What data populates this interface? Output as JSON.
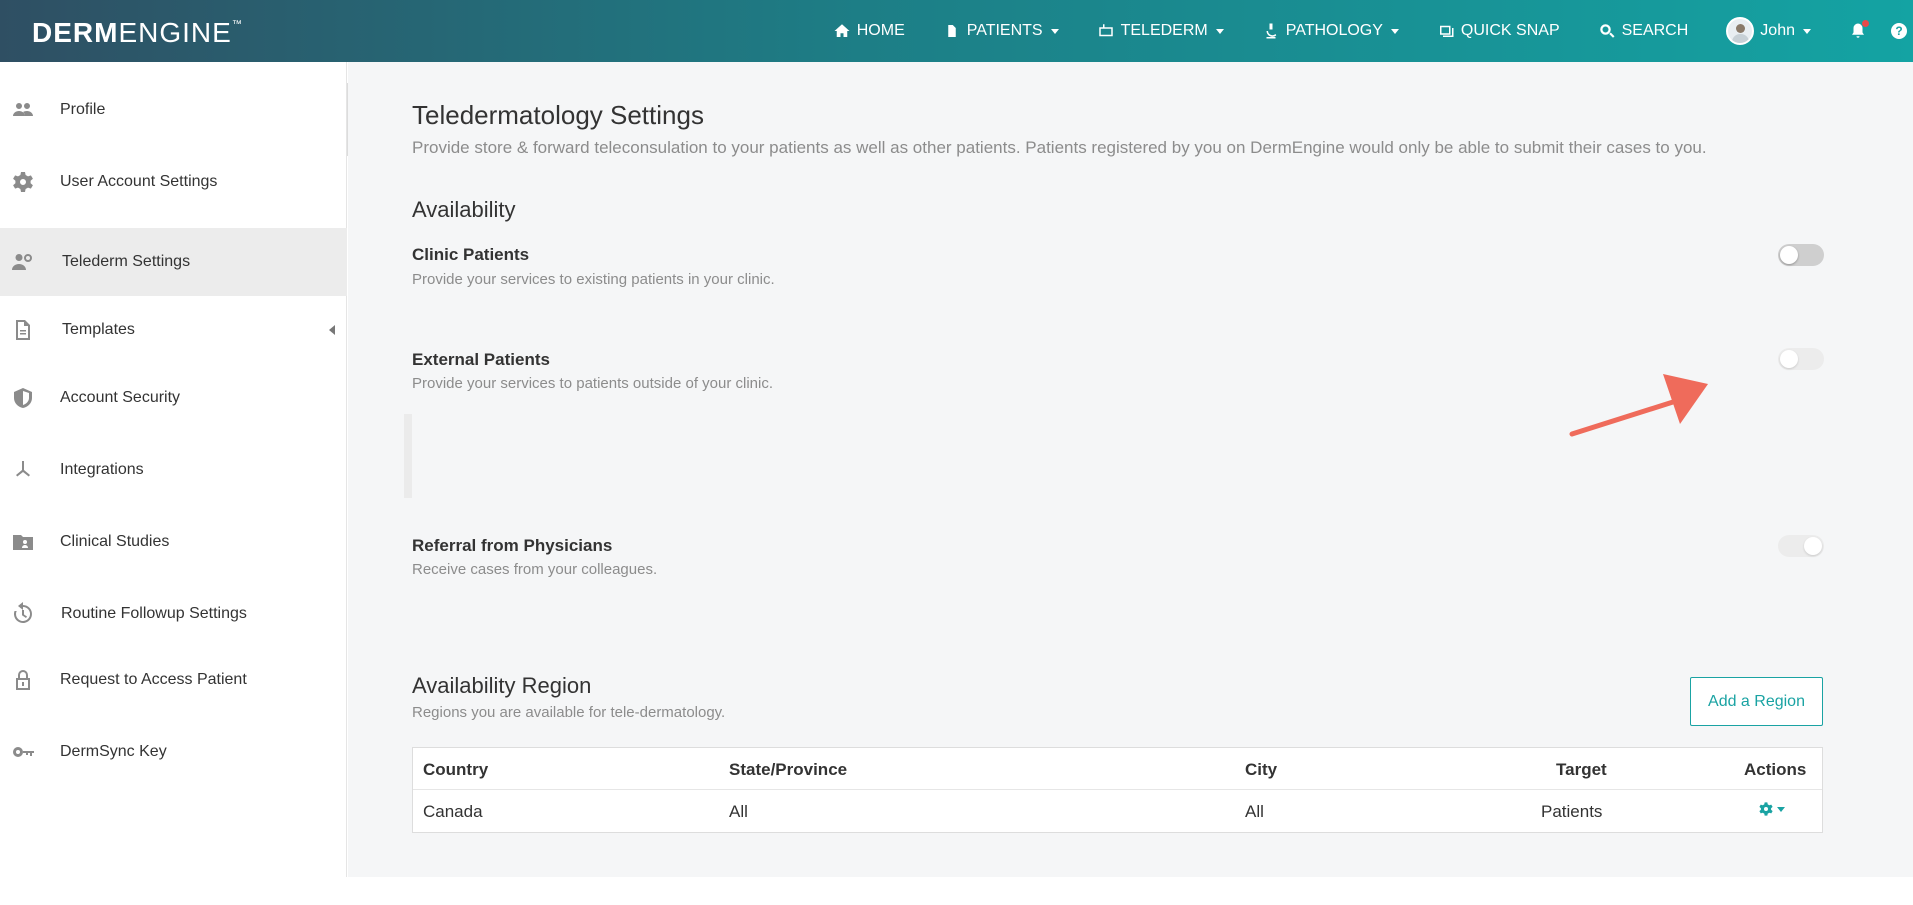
{
  "brand": {
    "logo_bold": "DERM",
    "logo_thin": "ENGINE",
    "logo_tm": "™"
  },
  "nav": {
    "home": "HOME",
    "patients": "PATIENTS",
    "telederm": "TELEDERM",
    "pathology": "PATHOLOGY",
    "quick_snap": "QUICK SNAP",
    "search": "SEARCH",
    "user": "John"
  },
  "sidebar": {
    "items": [
      {
        "label": "Profile",
        "icon": "users-icon"
      },
      {
        "label": "User Account Settings",
        "icon": "gear-icon"
      },
      {
        "label": "Telederm Settings",
        "icon": "telederm-user-icon",
        "active": true
      },
      {
        "label": "Templates",
        "icon": "document-icon"
      },
      {
        "label": "Account Security",
        "icon": "shield-icon"
      },
      {
        "label": "Integrations",
        "icon": "integrations-icon"
      },
      {
        "label": "Clinical Studies",
        "icon": "folder-user-icon"
      },
      {
        "label": "Routine Followup Settings",
        "icon": "history-icon"
      },
      {
        "label": "Request to Access Patient",
        "icon": "lock-icon"
      },
      {
        "label": "DermSync Key",
        "icon": "key-icon"
      }
    ]
  },
  "page": {
    "title": "Teledermatology Settings",
    "description": "Provide store & forward teleconsulation to your patients as well as other patients. Patients registered by you on DermEngine would only be able to submit their cases to you."
  },
  "availability": {
    "title": "Availability",
    "options": [
      {
        "title": "Clinic Patients",
        "description": "Provide your services to existing patients in your clinic.",
        "enabled": false
      },
      {
        "title": "External Patients",
        "description": "Provide your services to patients outside of your clinic.",
        "enabled": false
      },
      {
        "title": "Referral from Physicians",
        "description": "Receive cases from your colleagues.",
        "enabled": true
      }
    ]
  },
  "region": {
    "title": "Availability Region",
    "description": "Regions you are available for tele-dermatology.",
    "add_button": "Add a Region",
    "columns": [
      "Country",
      "State/Province",
      "City",
      "Target",
      "Actions"
    ],
    "rows": [
      {
        "country": "Canada",
        "state": "All",
        "city": "All",
        "target": "Patients"
      }
    ]
  },
  "colors": {
    "accent": "#1aa3a3",
    "arrow": "#ef6b5b"
  }
}
